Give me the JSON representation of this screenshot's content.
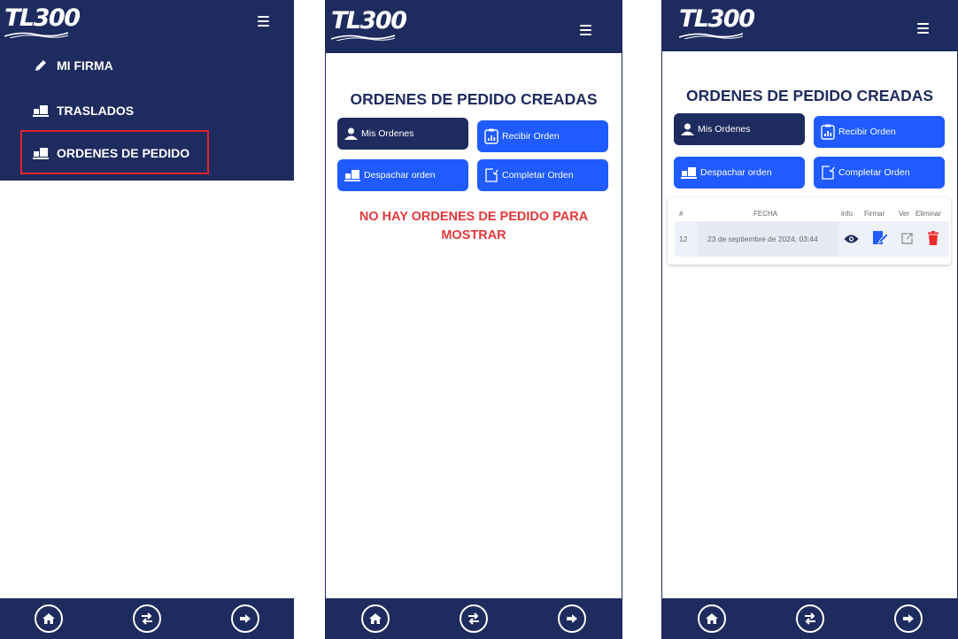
{
  "app": {
    "logo_text": "TL300"
  },
  "panel1": {
    "menu": [
      {
        "label": "MI FIRMA",
        "icon": "pencil-icon"
      },
      {
        "label": "TRASLADOS",
        "icon": "truck-loading-icon"
      },
      {
        "label": "ORDENES DE PEDIDO",
        "icon": "truck-loading-icon",
        "highlighted": true
      }
    ]
  },
  "panel2": {
    "title": "ORDENES DE PEDIDO CREADAS",
    "buttons": {
      "mis_ordenes": "Mis Ordenes",
      "recibir_orden": "Recibir Orden",
      "despachar_orden": "Despachar orden",
      "completar_orden": "Completar Orden"
    },
    "empty_message": "NO HAY ORDENES DE PEDIDO PARA MOSTRAR"
  },
  "panel3": {
    "title": "ORDENES DE PEDIDO CREADAS",
    "buttons": {
      "mis_ordenes": "Mis Ordenes",
      "recibir_orden": "Recibir Orden",
      "despachar_orden": "Despachar orden",
      "completar_orden": "Completar Orden"
    },
    "table": {
      "headers": [
        "#",
        "FECHA",
        "info",
        "Firmar",
        "Ver",
        "Eliminar"
      ],
      "rows": [
        {
          "id": "12",
          "fecha": "23 de septiembre de 2024, 03:44"
        }
      ]
    }
  },
  "bottom_nav": [
    "home-icon",
    "exchange-icon",
    "logout-icon"
  ],
  "colors": {
    "navy": "#1e2b5e",
    "blue": "#1f5bff",
    "red": "#e5393b",
    "highlight": "#e0242b"
  }
}
